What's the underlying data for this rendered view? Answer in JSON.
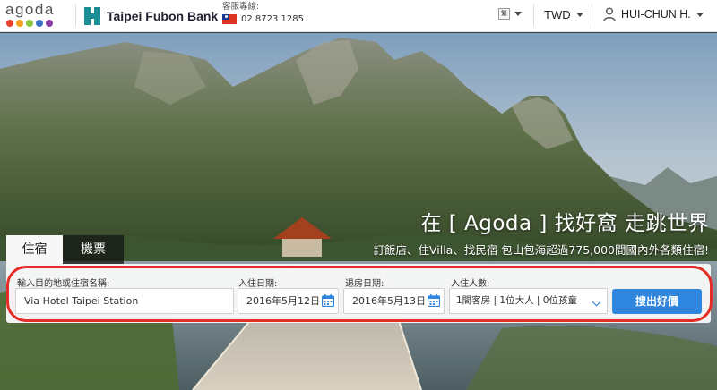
{
  "header": {
    "logo_text": "agoda",
    "logo_dot_colors": [
      "#e8412a",
      "#f4a21c",
      "#8dc63f",
      "#3a74c9",
      "#8a3fa8"
    ],
    "partner_name": "Taipei Fubon Bank",
    "support_label": "客服專線:",
    "support_phone": "02 8723 1285",
    "lang_badge": "繁",
    "currency": "TWD",
    "user_name": "HUI-CHUN H."
  },
  "hero": {
    "title": "在 [ Agoda ] 找好窩 走跳世界",
    "subtitle": "訂飯店、住Villa、找民宿 包山包海超過775,000間國內外各類住宿!"
  },
  "tabs": [
    {
      "label": "住宿",
      "active": true
    },
    {
      "label": "機票",
      "active": false
    }
  ],
  "search": {
    "destination_label": "輸入目的地或住宿名稱:",
    "destination_value": "Via Hotel Taipei Station",
    "checkin_label": "入住日期:",
    "checkin_value": "2016年5月12日",
    "checkout_label": "退房日期:",
    "checkout_value": "2016年5月13日",
    "guests_label": "入住人數:",
    "guests_value": "1間客房 | 1位大人 | 0位孩童",
    "submit_label": "搜出好價"
  },
  "colors": {
    "accent_blue": "#2e86de",
    "highlight_red": "#e52d27"
  }
}
